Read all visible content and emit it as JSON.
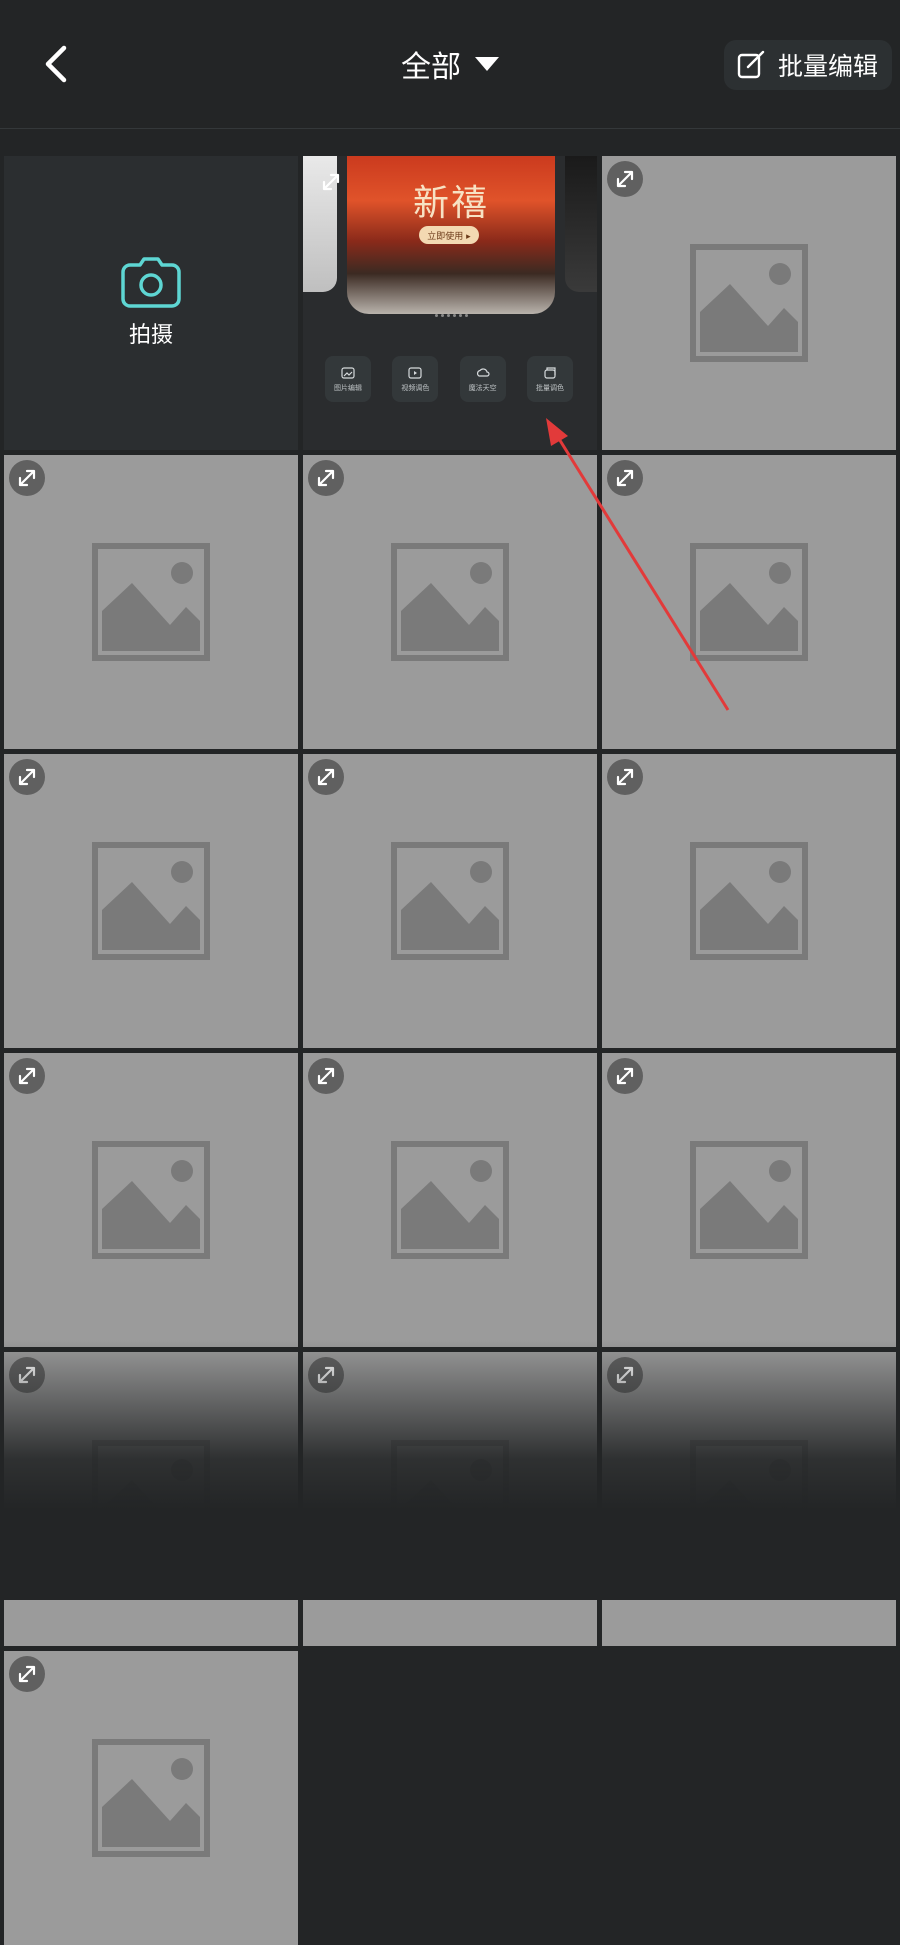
{
  "header": {
    "title": "全部",
    "batch_edit_label": "批量编辑"
  },
  "camera": {
    "label": "拍摄"
  },
  "promo": {
    "banner_title": "新禧",
    "banner_button": "立即使用 ▸",
    "tools": [
      {
        "label": "图片编辑",
        "icon": "image-edit-icon"
      },
      {
        "label": "视频调色",
        "icon": "video-color-icon"
      },
      {
        "label": "魔法天空",
        "icon": "magic-sky-icon"
      },
      {
        "label": "批量调色",
        "icon": "batch-color-icon"
      }
    ]
  },
  "colors": {
    "accent": "#5ed6d3",
    "annotation_arrow": "#e23a3a",
    "placeholder_bg": "#9b9b9b",
    "placeholder_icon": "#7a7a7a"
  },
  "media_placeholder_count": 14
}
